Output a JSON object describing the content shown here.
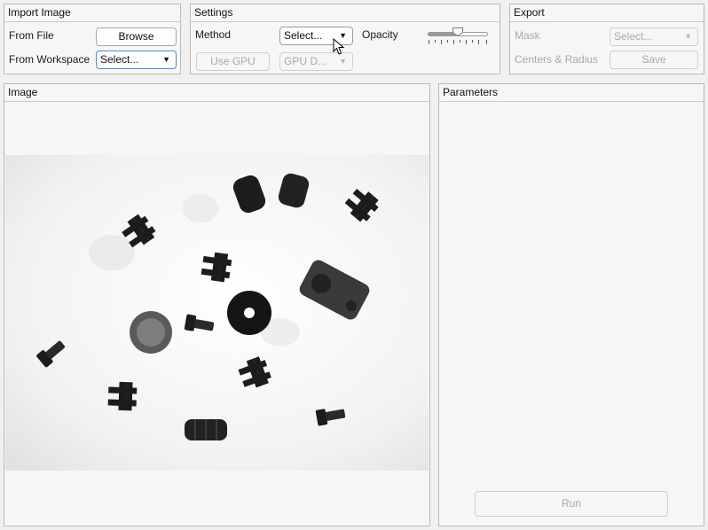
{
  "import_panel": {
    "title": "Import Image",
    "from_file_label": "From File",
    "browse_label": "Browse",
    "from_workspace_label": "From Workspace",
    "workspace_select": "Select..."
  },
  "settings_panel": {
    "title": "Settings",
    "method_label": "Method",
    "method_select": "Select...",
    "opacity_label": "Opacity",
    "opacity_value": 0.5,
    "use_gpu_label": "Use GPU",
    "gpu_select": "GPU D..."
  },
  "export_panel": {
    "title": "Export",
    "mask_label": "Mask",
    "mask_select": "Select...",
    "centers_label": "Centers & Radius",
    "save_label": "Save"
  },
  "image_panel": {
    "title": "Image"
  },
  "parameters_panel": {
    "title": "Parameters",
    "run_label": "Run"
  },
  "icons": {
    "dropdown": "chevron-down-icon",
    "cursor": "mouse-pointer-icon"
  },
  "colors": {
    "panel_bg": "#f6f6f6",
    "border": "#b9b9b9",
    "focus": "#4a8ad8",
    "disabled_text": "#a8a8a8"
  }
}
